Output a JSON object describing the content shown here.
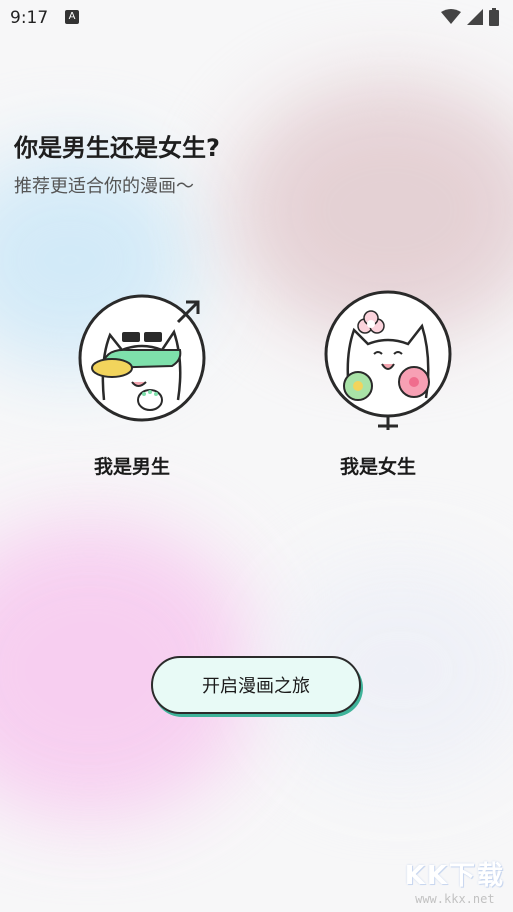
{
  "status_bar": {
    "time": "9:17",
    "notification_glyph": "A"
  },
  "header": {
    "title": "你是男生还是女生?",
    "subtitle": "推荐更适合你的漫画～"
  },
  "choices": {
    "male": {
      "label": "我是男生",
      "icon": "male-symbol"
    },
    "female": {
      "label": "我是女生",
      "icon": "female-symbol"
    }
  },
  "start_button": {
    "label": "开启漫画之旅"
  },
  "watermark": {
    "logo": "KK下载",
    "url": "www.kkx.net"
  },
  "colors": {
    "button_fill": "#e8faf6",
    "button_shadow": "#3fb39a",
    "text_primary": "#1e1e1e"
  }
}
